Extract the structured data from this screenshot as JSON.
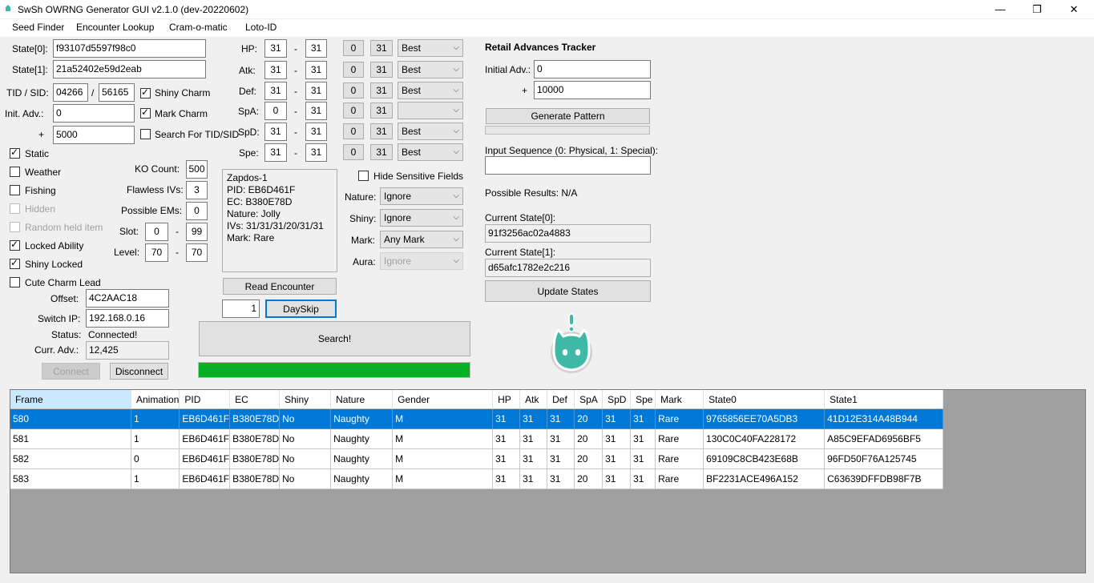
{
  "window": {
    "title": "SwSh OWRNG Generator GUI v2.1.0 (dev-20220602)"
  },
  "window_controls": {
    "minimize": "—",
    "maximize": "❐",
    "close": "✕"
  },
  "menu": [
    "Seed Finder",
    "Encounter Lookup",
    "Cram-o-matic",
    "Loto-ID"
  ],
  "left": {
    "state0_label": "State[0]:",
    "state0": "f93107d5597f98c0",
    "state1_label": "State[1]:",
    "state1": "21a52402e59d2eab",
    "tidsid_label": "TID / SID:",
    "tid": "04266",
    "slash": "/",
    "sid": "56165",
    "shiny_charm": "Shiny Charm",
    "mark_charm": "Mark Charm",
    "search_tid": "Search For TID/SID",
    "init_adv_label": "Init. Adv.:",
    "init_adv": "0",
    "plus": "+",
    "plus_adv": "5000",
    "static": "Static",
    "weather": "Weather",
    "fishing": "Fishing",
    "hidden": "Hidden",
    "random_held": "Random held item",
    "locked_ability": "Locked Ability",
    "shiny_locked": "Shiny Locked",
    "cute_charm": "Cute Charm Lead",
    "ko_label": "KO Count:",
    "ko": "500",
    "flawless_label": "Flawless IVs:",
    "flawless": "3",
    "ems_label": "Possible EMs:",
    "ems": "0",
    "slot_label": "Slot:",
    "slot_min": "0",
    "slot_max": "99",
    "dash": "-",
    "level_label": "Level:",
    "level_min": "70",
    "level_max": "70",
    "offset_label": "Offset:",
    "offset": "4C2AAC18",
    "ip_label": "Switch IP:",
    "ip": "192.168.0.16",
    "status_label": "Status:",
    "status": "Connected!",
    "curr_label": "Curr. Adv.:",
    "curr": "12,425",
    "connect": "Connect",
    "disconnect": "Disconnect"
  },
  "ivs": {
    "dash": "-",
    "zero": "0",
    "max": "31",
    "rows": [
      {
        "label": "HP:",
        "min": "31",
        "max": "31",
        "mode": "Best"
      },
      {
        "label": "Atk:",
        "min": "31",
        "max": "31",
        "mode": "Best"
      },
      {
        "label": "Def:",
        "min": "31",
        "max": "31",
        "mode": "Best"
      },
      {
        "label": "SpA:",
        "min": "0",
        "max": "31",
        "mode": ""
      },
      {
        "label": "SpD:",
        "min": "31",
        "max": "31",
        "mode": "Best"
      },
      {
        "label": "Spe:",
        "min": "31",
        "max": "31",
        "mode": "Best"
      }
    ]
  },
  "encounter_info": [
    "Zapdos-1",
    "PID: EB6D461F",
    "EC: B380E78D",
    "Nature: Jolly",
    "IVs: 31/31/31/20/31/31",
    "Mark: Rare"
  ],
  "filters": {
    "hide_sensitive": "Hide Sensitive Fields",
    "nature_label": "Nature:",
    "nature": "Ignore",
    "shiny_label": "Shiny:",
    "shiny": "Ignore",
    "mark_label": "Mark:",
    "mark": "Any Mark",
    "aura_label": "Aura:",
    "aura": "Ignore"
  },
  "actions": {
    "read_encounter": "Read Encounter",
    "dayskip_count": "1",
    "dayskip": "DaySkip",
    "search": "Search!",
    "progress": 100
  },
  "retail": {
    "title": "Retail Advances Tracker",
    "initial_label": "Initial Adv.:",
    "initial": "0",
    "plus": "+",
    "plus_value": "10000",
    "generate": "Generate Pattern",
    "input_seq_label": "Input Sequence (0: Physical, 1: Special):",
    "input_seq": "",
    "possible": "Possible Results: N/A",
    "cs0_label": "Current State[0]:",
    "cs0": "91f3256ac02a4883",
    "cs1_label": "Current State[1]:",
    "cs1": "d65afc1782e2c216",
    "update": "Update States"
  },
  "results": {
    "columns": [
      "Frame",
      "Animation",
      "PID",
      "EC",
      "Shiny",
      "Nature",
      "Gender",
      "HP",
      "Atk",
      "Def",
      "SpA",
      "SpD",
      "Spe",
      "Mark",
      "State0",
      "State1"
    ],
    "rows": [
      [
        "580",
        "1",
        "EB6D461F",
        "B380E78D",
        "No",
        "Naughty",
        "M",
        "31",
        "31",
        "31",
        "20",
        "31",
        "31",
        "Rare",
        "9765856EE70A5DB3",
        "41D12E314A48B944"
      ],
      [
        "581",
        "1",
        "EB6D461F",
        "B380E78D",
        "No",
        "Naughty",
        "M",
        "31",
        "31",
        "31",
        "20",
        "31",
        "31",
        "Rare",
        "130C0C40FA228172",
        "A85C9EFAD6956BF5"
      ],
      [
        "582",
        "0",
        "EB6D461F",
        "B380E78D",
        "No",
        "Naughty",
        "M",
        "31",
        "31",
        "31",
        "20",
        "31",
        "31",
        "Rare",
        "69109C8CB423E68B",
        "96FD50F76A125745"
      ],
      [
        "583",
        "1",
        "EB6D461F",
        "B380E78D",
        "No",
        "Naughty",
        "M",
        "31",
        "31",
        "31",
        "20",
        "31",
        "31",
        "Rare",
        "BF2231ACE496A152",
        "C63639DFFDB98F7B"
      ]
    ]
  },
  "colors": {
    "selection": "#0078d7",
    "progress": "#06b025",
    "mascot": "#3eb8a7"
  }
}
